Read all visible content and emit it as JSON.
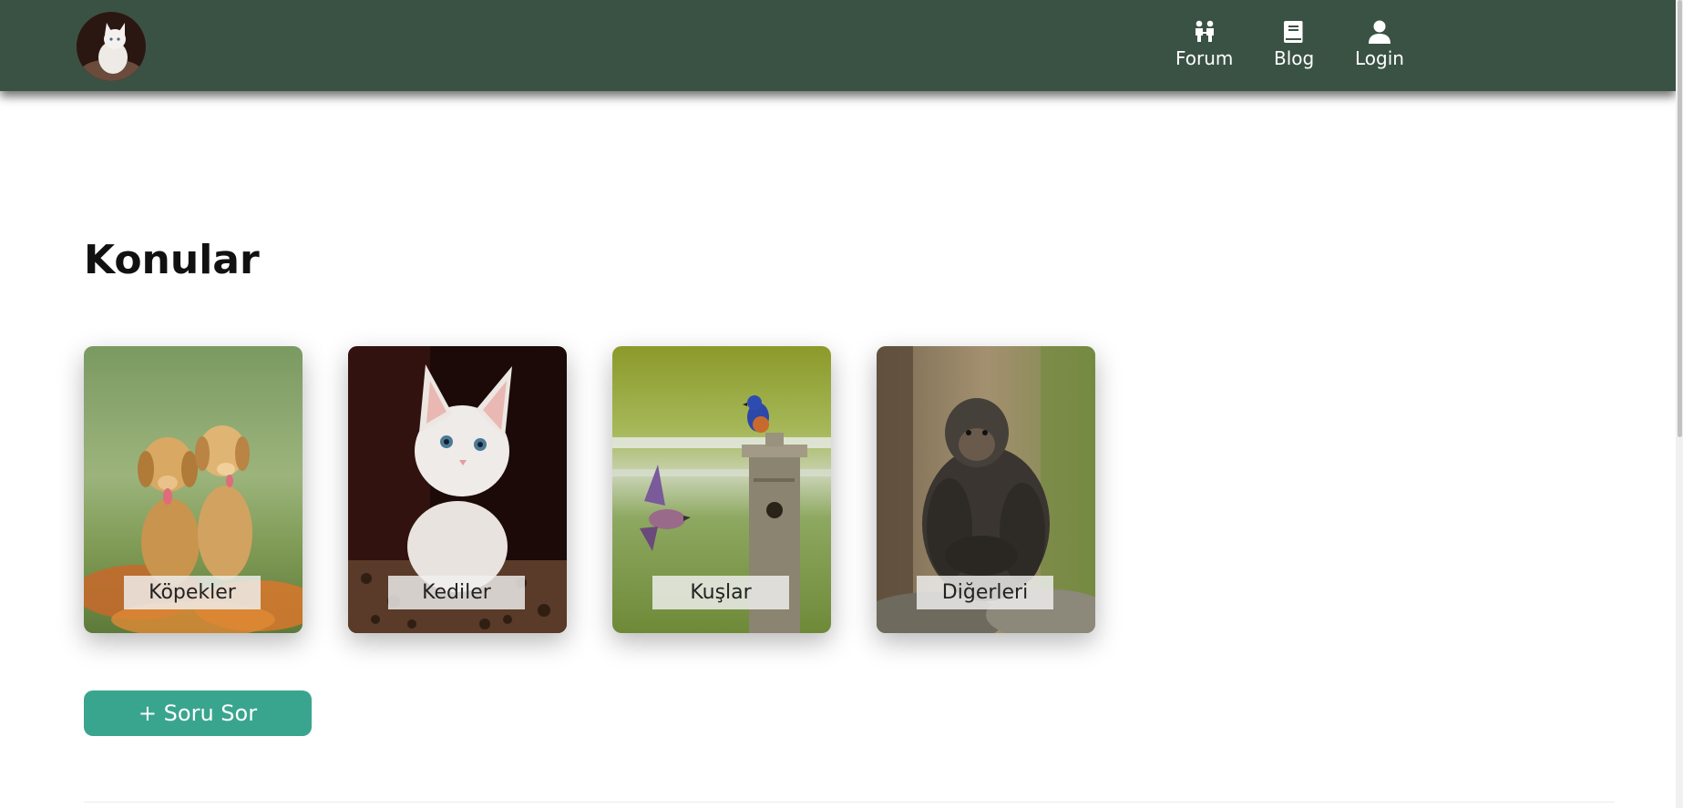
{
  "header": {
    "logo_icon": "cat-avatar-logo",
    "nav": [
      {
        "label": "Forum",
        "icon": "people-icon"
      },
      {
        "label": "Blog",
        "icon": "book-icon"
      },
      {
        "label": "Login",
        "icon": "user-icon"
      }
    ],
    "background_color": "#3a5244"
  },
  "main": {
    "title": "Konular",
    "categories": [
      {
        "label": "Köpekler",
        "image": "two golden retriever puppies in orange flower field"
      },
      {
        "label": "Kediler",
        "image": "white kitten on leopard-print blanket"
      },
      {
        "label": "Kuşlar",
        "image": "bluebirds at wooden birdhouse"
      },
      {
        "label": "Diğerleri",
        "image": "chimpanzee sitting on rocks"
      }
    ],
    "ask_button_label": "+ Soru Sor",
    "accent_color": "#3aa58f"
  }
}
